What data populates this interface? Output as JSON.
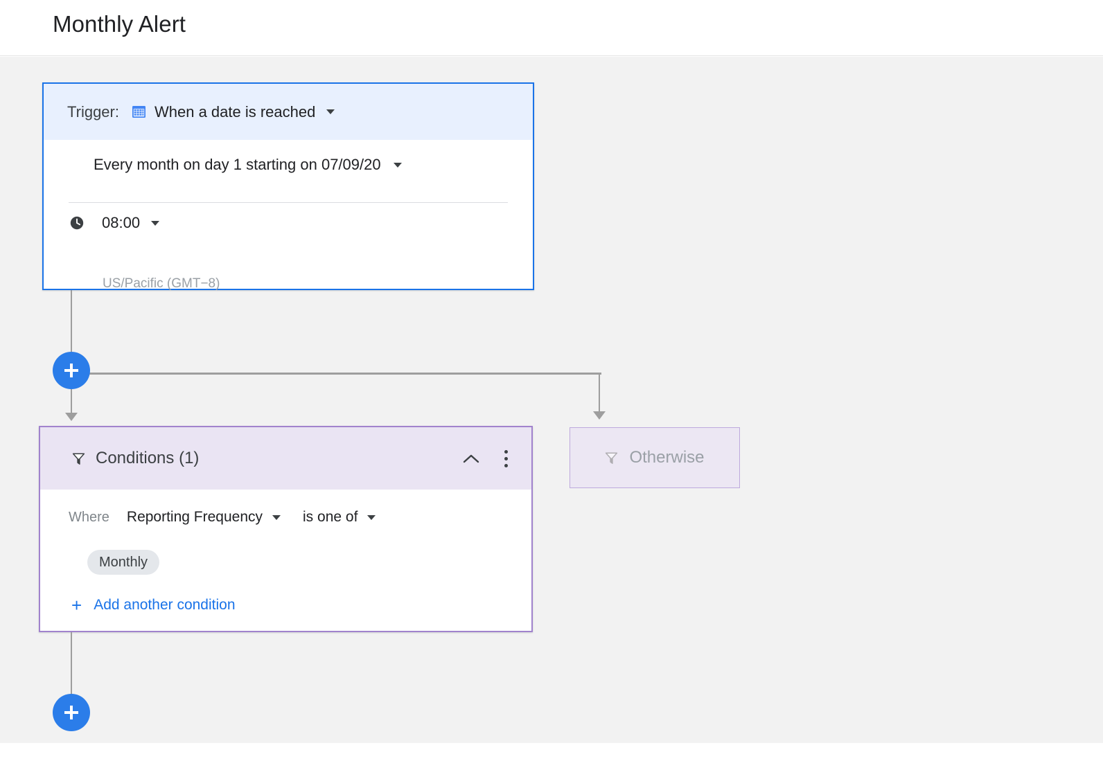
{
  "header": {
    "title": "Monthly Alert"
  },
  "trigger": {
    "label": "Trigger:",
    "icon": "calendar-icon",
    "type_value": "When a date is reached",
    "schedule_value": "Every month on day 1 starting on 07/09/20",
    "time_icon": "clock-icon",
    "time_value": "08:00",
    "timezone": "US/Pacific (GMT−8)"
  },
  "conditions": {
    "icon": "funnel-icon",
    "title": "Conditions (1)",
    "collapse_icon": "chevron-up-icon",
    "menu_icon": "more-vert-icon",
    "where_label": "Where",
    "field_value": "Reporting Frequency",
    "operator_value": "is one of",
    "chips": [
      "Monthly"
    ],
    "add_condition_plus": "+",
    "add_condition_label": "Add another condition"
  },
  "otherwise": {
    "icon": "funnel-icon",
    "label": "Otherwise"
  },
  "nodes": {
    "add_step_top": "+",
    "add_step_bottom": "+"
  },
  "colors": {
    "accent_blue": "#1a73e8",
    "node_blue": "#2b7de9",
    "trigger_header_bg": "#e8f0fe",
    "conditions_border": "#a183cd",
    "conditions_header_bg": "#eae4f3",
    "otherwise_bg": "#ece7f3",
    "canvas_bg": "#f2f2f2",
    "connector_gray": "#9e9e9e"
  }
}
